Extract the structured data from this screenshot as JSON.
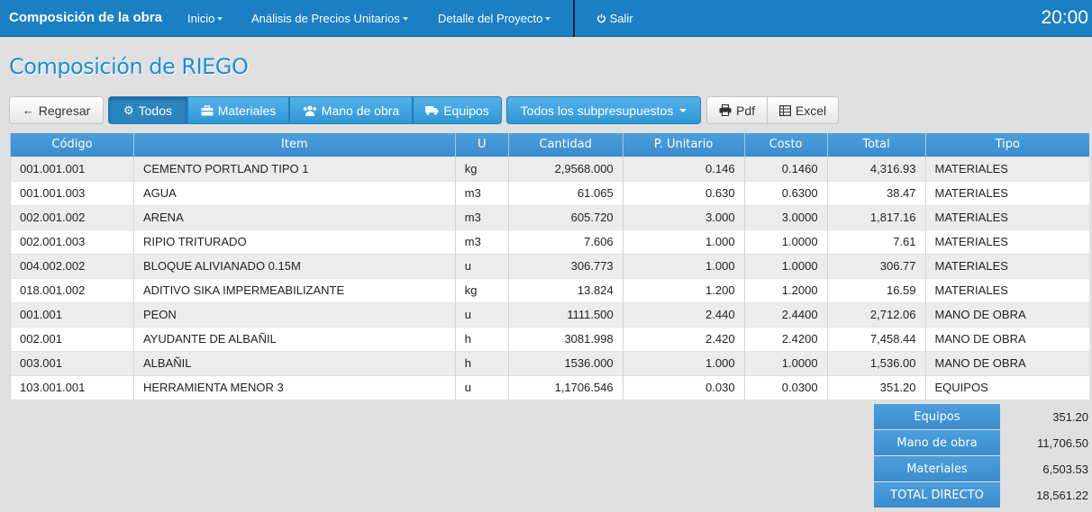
{
  "nav": {
    "brand": "Composición de la obra",
    "inicio": "Inicio",
    "apu": "Análisis de Precios Unitarios",
    "detalle": "Detalle del Proyecto",
    "salir": "Salir",
    "clock": "20:00"
  },
  "page": {
    "title": "Composición de RIEGO"
  },
  "toolbar": {
    "regresar": "Regresar",
    "todos": "Todos",
    "materiales": "Materiales",
    "mano_obra": "Mano de obra",
    "equipos": "Equipos",
    "subpresupuestos": "Todos los subpresupuestos",
    "pdf": "Pdf",
    "excel": "Excel"
  },
  "table": {
    "headers": [
      "Código",
      "Item",
      "U",
      "Cantidad",
      "P. Unitario",
      "Costo",
      "Total",
      "Tipo"
    ],
    "rows": [
      [
        "001.001.001",
        "CEMENTO PORTLAND TIPO 1",
        "kg",
        "2,9568.000",
        "0.146",
        "0.1460",
        "4,316.93",
        "MATERIALES"
      ],
      [
        "001.001.003",
        "AGUA",
        "m3",
        "61.065",
        "0.630",
        "0.6300",
        "38.47",
        "MATERIALES"
      ],
      [
        "002.001.002",
        "ARENA",
        "m3",
        "605.720",
        "3.000",
        "3.0000",
        "1,817.16",
        "MATERIALES"
      ],
      [
        "002.001.003",
        "RIPIO TRITURADO",
        "m3",
        "7.606",
        "1.000",
        "1.0000",
        "7.61",
        "MATERIALES"
      ],
      [
        "004.002.002",
        "BLOQUE ALIVIANADO 0.15M",
        "u",
        "306.773",
        "1.000",
        "1.0000",
        "306.77",
        "MATERIALES"
      ],
      [
        "018.001.002",
        "ADITIVO SIKA IMPERMEABILIZANTE",
        "kg",
        "13.824",
        "1.200",
        "1.2000",
        "16.59",
        "MATERIALES"
      ],
      [
        "001.001",
        "PEON",
        "u",
        "1111.500",
        "2.440",
        "2.4400",
        "2,712.06",
        "MANO DE OBRA"
      ],
      [
        "002.001",
        "AYUDANTE DE ALBAÑIL",
        "h",
        "3081.998",
        "2.420",
        "2.4200",
        "7,458.44",
        "MANO DE OBRA"
      ],
      [
        "003.001",
        "ALBAÑIL",
        "h",
        "1536.000",
        "1.000",
        "1.0000",
        "1,536.00",
        "MANO DE OBRA"
      ],
      [
        "103.001.001",
        "HERRAMIENTA MENOR 3",
        "u",
        "1,1706.546",
        "0.030",
        "0.0300",
        "351.20",
        "EQUIPOS"
      ]
    ]
  },
  "summary": [
    {
      "label": "Equipos",
      "value": "351.20"
    },
    {
      "label": "Mano de obra",
      "value": "11,706.50"
    },
    {
      "label": "Materiales",
      "value": "6,503.53"
    },
    {
      "label": "TOTAL DIRECTO",
      "value": "18,561.22"
    }
  ],
  "icons": {
    "arrow": "arrow-left-icon",
    "cogs": "cogs-icon",
    "briefcase": "briefcase-icon",
    "users": "users-icon",
    "truck": "truck-icon",
    "print": "print-icon",
    "table": "table-icon",
    "power": "power-icon"
  },
  "colors": {
    "navbar": "#1b7fc4",
    "accent": "#3a8ccd",
    "title": "#1a8fd6"
  }
}
